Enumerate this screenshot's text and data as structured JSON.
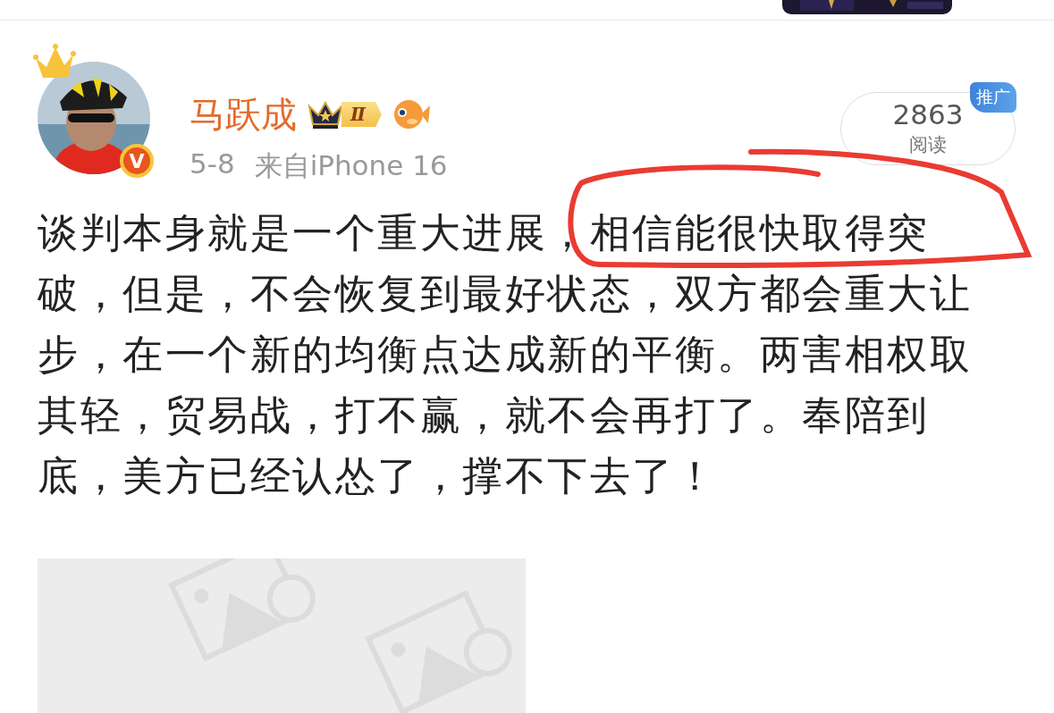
{
  "author": {
    "name": "马跃成",
    "verified_badge": "V",
    "level_badge": "Ⅱ"
  },
  "meta": {
    "time": "5-8",
    "source": "来自iPhone 16"
  },
  "read_count": {
    "value": "2863",
    "label": "阅读",
    "tag": "推广"
  },
  "content": "谈判本身就是一个重大进展，相信能很快取得突破，但是，不会恢复到最好状态，双方都会重大让步，在一个新的均衡点达成新的平衡。两害相权取其轻，贸易战，打不赢，就不会再打了。奉陪到底，美方已经认怂了，撑不下去了！",
  "media": {
    "kind": "broken_image"
  }
}
